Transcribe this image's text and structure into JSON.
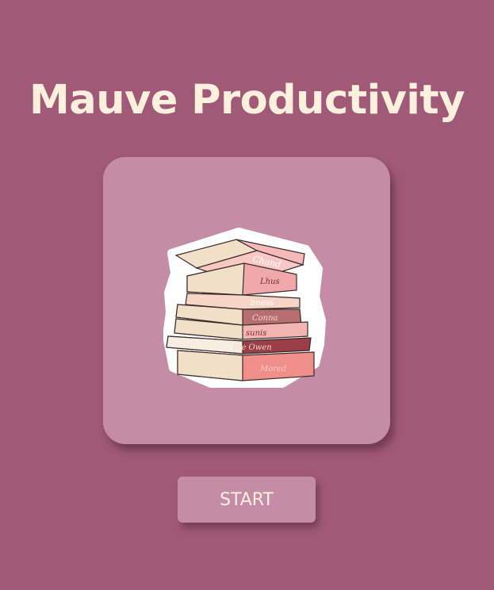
{
  "header": {
    "title": "Mauve Productivity"
  },
  "illustration": {
    "icon": "stack-of-books-sticker",
    "spine_texts": [
      "Chand",
      "Lhus",
      "bness",
      "Conna",
      "sunis",
      "the Owen",
      "Mored"
    ]
  },
  "actions": {
    "start_label": "START"
  },
  "colors": {
    "background": "#a05a78",
    "card": "#c48ca7",
    "title_text": "#fdf0dc",
    "button": "#c48ca7",
    "button_text": "#fdf0dc"
  }
}
